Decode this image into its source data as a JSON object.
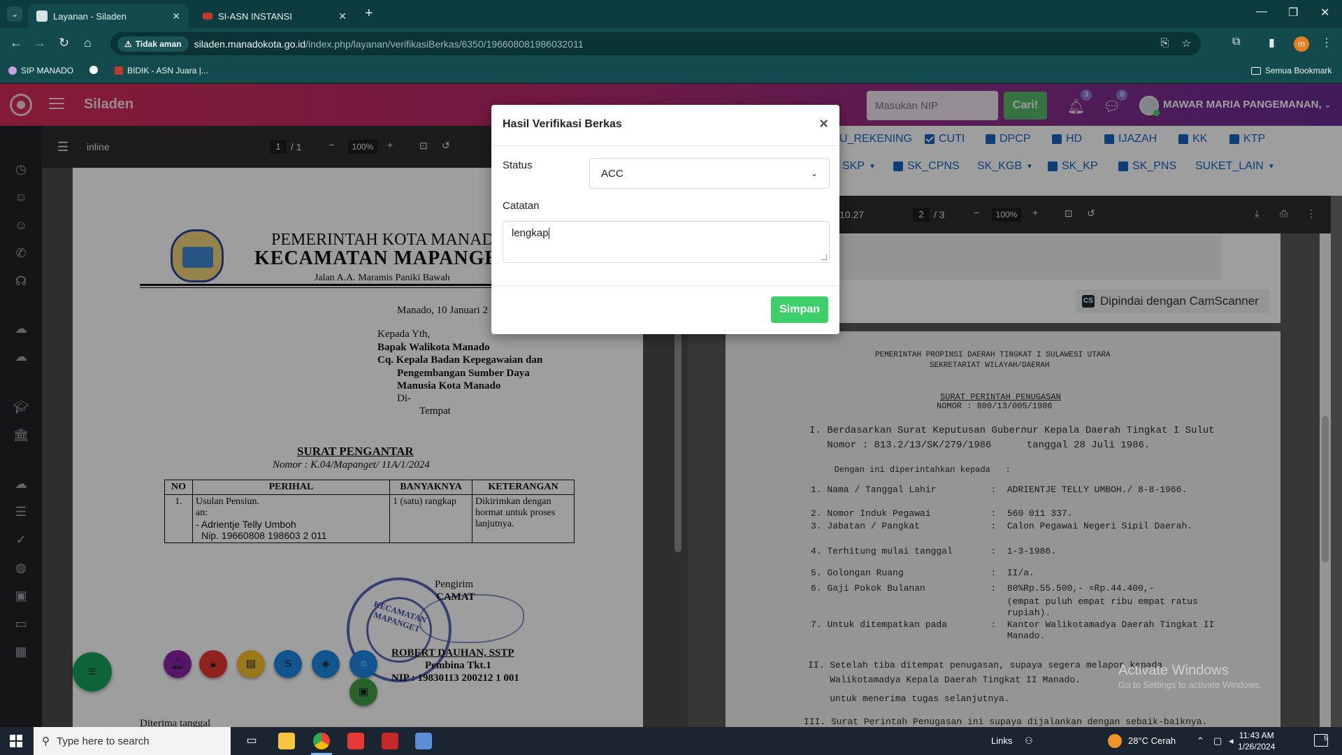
{
  "browser": {
    "tabs": [
      {
        "title": "Layanan - Siladen",
        "active": true
      },
      {
        "title": "SI-ASN INSTANSI",
        "active": false
      }
    ],
    "address": {
      "security_label": "Tidak aman",
      "url_host": "siladen.manadokota.go.id",
      "url_path": "/index.php/layanan/verifikasiBerkas/6350/196608081986032011"
    },
    "profile_initial": "m",
    "bookmarks": [
      "SIP MANADO",
      "BIDIK - ASN Juara |...",
      "Semua Bookmark"
    ]
  },
  "app": {
    "brand": "Siladen",
    "nip_placeholder": "Masukan NIP",
    "search_button": "Cari!",
    "notif_count": "3",
    "message_count": "8",
    "user_name": "MAWAR MARIA PANGEMANAN,"
  },
  "left_viewer": {
    "label": "inline",
    "page_current": "1",
    "page_total": "/ 1",
    "zoom": "100%"
  },
  "letter": {
    "kop_line1": "PEMERINTAH KOTA MANADO",
    "kop_line2": "KECAMATAN MAPANGE",
    "kop_line3": "Jalan A.A. Maramis Paniki Bawah",
    "date": "Manado, 10 Januari 2",
    "to_lines": [
      "Kepada Yth,",
      "Bapak Walikota Manado",
      "Cq. Kepala Badan Kepegawaian dan",
      "Pengembangan Sumber Daya",
      "Manusia Kota Manado",
      "Di-",
      "Tempat"
    ],
    "title": "SURAT PENGANTAR",
    "nomor": "Nomor : K.04/Mapanget/ 11A/1/2024",
    "table": {
      "headers": [
        "NO",
        "PERIHAL",
        "BANYAKNYA",
        "KETERANGAN"
      ],
      "row": {
        "no": "1.",
        "perihal_lines": [
          "Usulan Pensiun.",
          "an:",
          "- Adrientje Telly Umboh",
          "Nip. 19660808 198603 2 011"
        ],
        "banyak": "1 (satu) rangkap",
        "ket_lines": [
          "Dikirimkan dengan",
          "hormat untuk proses",
          "lanjutnya."
        ]
      }
    },
    "stamp_text": "KECAMATAN MAPANGET",
    "sender": "Pengirim",
    "camat": "CAMAT",
    "signer": "ROBERT DAUHAN, SSTP",
    "rank": "Pembina Tkt.1",
    "nip": "NIP : 19830113 200212 1 001",
    "received": "Diterima tanggal"
  },
  "right_tabs": {
    "row1": [
      {
        "label": "U_REKENING",
        "checkbox": false
      },
      {
        "label": "CUTI",
        "checkbox": true,
        "checked": true
      },
      {
        "label": "DPCP",
        "checkbox": true
      },
      {
        "label": "HD",
        "checkbox": true
      },
      {
        "label": "IJAZAH",
        "checkbox": true
      },
      {
        "label": "KK",
        "checkbox": true
      },
      {
        "label": "KTP",
        "checkbox": true
      }
    ],
    "row2": [
      {
        "label": "SKP",
        "dropdown": true
      },
      {
        "label": "SK_CPNS",
        "checkbox": true
      },
      {
        "label": "SK_KGB",
        "dropdown": true
      },
      {
        "label": "SK_KP",
        "checkbox": true
      },
      {
        "label": "SK_PNS",
        "checkbox": true
      },
      {
        "label": "SUKET_LAIN",
        "dropdown": true
      }
    ]
  },
  "right_viewer": {
    "file_suffix": "10.27",
    "page_current": "2",
    "page_total": "/ 3",
    "zoom": "100%",
    "camscanner_label": "Dipindai dengan CamScanner"
  },
  "scan": {
    "lines": [
      "PEMERINTAH PROPINSI DAERAH TINGKAT I SULAWESI UTARA",
      "SEKRETARIAT WILAYAH/DAERAH",
      "SURAT PERINTAH PENUGASAN",
      "NOMOR : 800/13/005/1986",
      "I. Berdasarkan Surat Keputusan Gubernur Kepala Daerah Tingkat I Sulut",
      "   Nomor : 813.2/13/SK/279/1986      tanggal 28 Juli 1986.",
      "   Dengan ini diperintahkan kepada   :",
      "1. Nama / Tanggal Lahir          :  ADRIENTJE TELLY UMBOH./ 8-8-1966.",
      "2. Nomor Induk Pegawai           :  560 011 337.",
      "3. Jabatan / Pangkat             :  Calon Pegawai Negeri Sipil Daerah.",
      "4. Terhitung mulai tanggal       :  1-3-1986.",
      "5. Golongan Ruang                :  II/a.",
      "6. Gaji Pokok Bulanan            :  80%Rp.55.500,- =Rp.44.400,-",
      "                                    (empat puluh empat ribu empat ratus",
      "                                    rupiah).",
      "7. Untuk ditempatkan pada        :  Kantor Walikotamadya Daerah Tingkat II",
      "                                    Manado.",
      "II. Setelah tiba ditempat penugasan, supaya segera melapor kepada",
      "    Walikotamadya Kepala Daerah Tingkat II Manado.",
      "    untuk menerima tugas selanjutnya.",
      "III. Surat Perintah Penugasan ini supaya dijalankan dengan sebaik-baiknya."
    ]
  },
  "modal": {
    "title": "Hasil Verifikasi Berkas",
    "close": "×",
    "status_label": "Status",
    "status_value": "ACC",
    "catatan_label": "Catatan",
    "catatan_value": "lengkap",
    "submit": "Simpan"
  },
  "watermark": {
    "line1": "Activate Windows",
    "line2": "Go to Settings to activate Windows."
  },
  "taskbar": {
    "search_placeholder": "Type here to search",
    "links": "Links",
    "weather": "28°C  Cerah",
    "time": "11:43 AM",
    "date": "1/26/2024",
    "notif_count": "5"
  }
}
